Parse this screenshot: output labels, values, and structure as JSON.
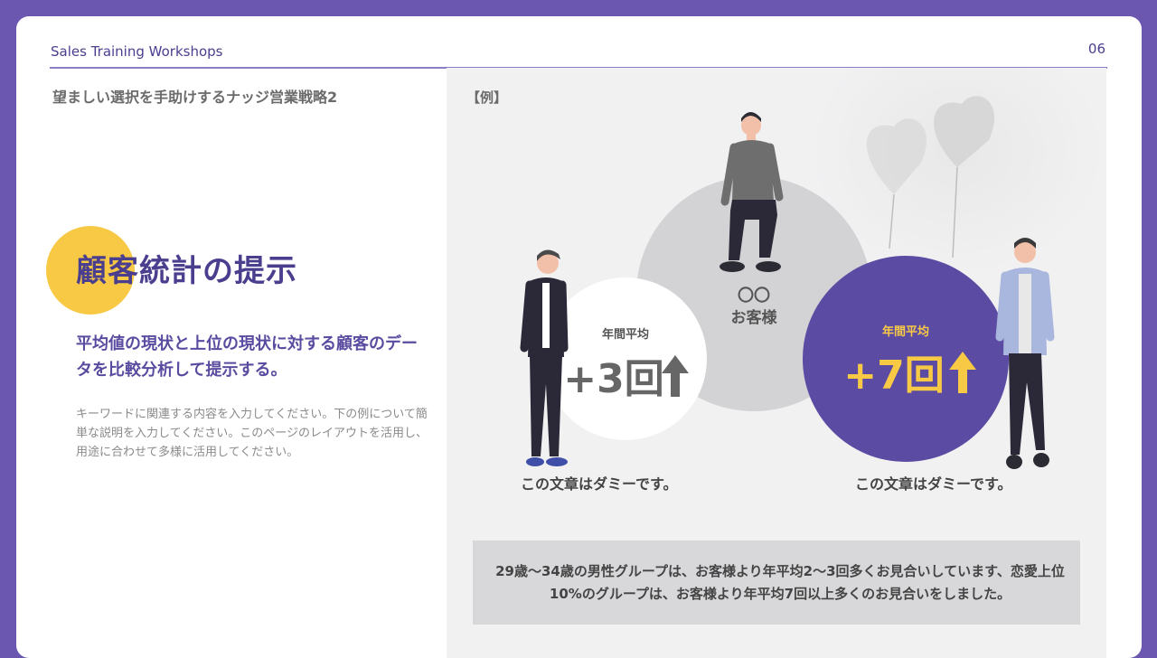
{
  "header": {
    "brand": "Sales Training Workshops",
    "page_number": "06"
  },
  "left": {
    "subtitle": "望ましい選択を手助けするナッジ営業戦略2",
    "title": "顧客統計の提示",
    "lead": "平均値の現状と上位の現状に対する顧客のデータを比較分析して提示する。",
    "body": "キーワードに関連する内容を入力してください。下の例について簡単な説明を入力してください。このページのレイアウトを活用し、用途に合わせて多様に活用してください。"
  },
  "example": {
    "label": "【例】",
    "customer": {
      "mark": "〇〇",
      "name": "お客様"
    },
    "stat_left": {
      "label": "年間平均",
      "value": "+3回"
    },
    "stat_right": {
      "label": "年間平均",
      "value": "+7回"
    },
    "caption_left": "この文章はダミーです。",
    "caption_right": "この文章はダミーです。",
    "summary": "29歳～34歳の男性グループは、お客様より年平均2～3回多くお見合いしています、恋愛上位10%のグループは、お客様より年平均7回以上多くのお見合いをしました。"
  },
  "colors": {
    "accent": "#5b4ba3",
    "yellow": "#f7c945",
    "frame": "#6b57b0"
  }
}
